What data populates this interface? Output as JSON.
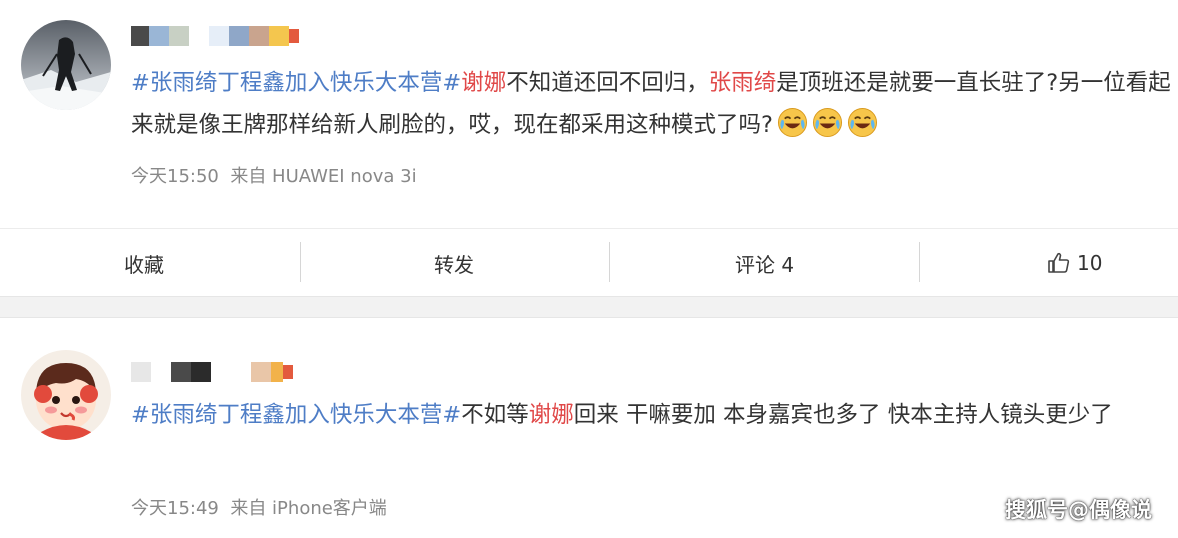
{
  "post1": {
    "content": {
      "topic": "#张雨绮丁程鑫加入快乐大本营#",
      "mention1": "谢娜",
      "text1": "不知道还回不回归，",
      "mention2": "张雨绮",
      "text2": "是顶班还是就要一直长驻了?另一位看起来就是像王牌那样给新人刷脸的，哎，现在都采用这种模式了吗?"
    },
    "emojis": [
      "laugh-cry-icon",
      "laugh-cry-icon",
      "laugh-cry-icon"
    ],
    "time": "今天15:50",
    "source": "来自 HUAWEI nova 3i"
  },
  "actions": {
    "collect": "收藏",
    "repost": "转发",
    "comment": "评论 4",
    "like_count": "10"
  },
  "post2": {
    "content": {
      "topic": "#张雨绮丁程鑫加入快乐大本营#",
      "text1": "不如等",
      "mention1": "谢娜",
      "text2": "回来 干嘛要加 本身嘉宾也多了 快本主持人镜头更少了"
    },
    "time": "今天15:49",
    "source": "来自 iPhone客户端"
  },
  "watermark": "搜狐号@偶像说",
  "colors": {
    "topic": "#4e7dc6",
    "mention": "#e04848",
    "meta": "#888888",
    "gap": "#f2f2f2"
  }
}
